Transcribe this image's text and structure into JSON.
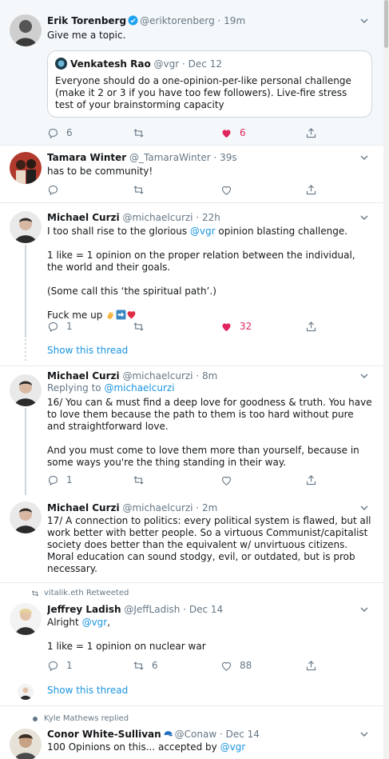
{
  "colors": {
    "accent": "#1b95e0",
    "like": "#e0245e",
    "muted": "#657786",
    "border": "#e6ecf0"
  },
  "tweets": [
    {
      "name": "Erik Torenberg",
      "handle": "@eriktorenberg",
      "time": "· 19m",
      "verified": true,
      "text": "Give me a topic.",
      "quote": {
        "name": "Venkatesh Rao",
        "handle": "@vgr",
        "time": "· Dec 12",
        "text": "Everyone should do a one-opinion-per-like personal challenge (make it 2 or 3 if you have too few followers). Live-fire stress test of your brainstorming capacity"
      },
      "reply_count": "6",
      "like_count": "6"
    },
    {
      "name": "Tamara Winter",
      "handle": "@_TamaraWinter",
      "time": "· 39s",
      "text": "has to be community!"
    },
    {
      "name": "Michael Curzi",
      "handle": "@michaelcurzi",
      "time": "· 22h",
      "line1_a": "I too shall rise to the glorious ",
      "line1_link": "@vgr",
      "line1_b": " opinion blasting challenge.",
      "para2": "1 like = 1 opinion on the proper relation between the individual, the world and their goals.",
      "para3": "(Some call this ‘the spiritual path’.)",
      "para4": "Fuck me up",
      "reply_count": "1",
      "like_count": "32"
    },
    {
      "name": "Michael Curzi",
      "handle": "@michaelcurzi",
      "time": "· 8m",
      "replying_label": "Replying to ",
      "replying_handle": "@michaelcurzi",
      "para1": "16/ You can & must find a deep love for goodness & truth. You have to love them because the path to them is too hard without pure and straightforward love.",
      "para2": "And you must come to love them more than yourself, because in some ways you're the thing standing in their way.",
      "reply_count": "1"
    },
    {
      "name": "Michael Curzi",
      "handle": "@michaelcurzi",
      "time": "· 2m",
      "text": "17/ A connection to politics: every political system is flawed, but all work better with better people. So a virtuous Communist/capitalist society does better than the equivalent w/ unvirtuous citizens. Moral education can sound stodgy, evil, or outdated, but is prob necessary."
    },
    {
      "context": "vitalik.eth Retweeted",
      "name": "Jeffrey Ladish",
      "handle": "@JeffLadish",
      "time": "· Dec 14",
      "line1_a": "Alright ",
      "line1_link": "@vgr",
      "line1_b": ",",
      "para2": "1 like = 1 opinion on nuclear war",
      "reply_count": "1",
      "retweet_count": "6",
      "like_count": "88"
    },
    {
      "context": "Kyle Mathews replied",
      "name": "Conor White-Sullivan",
      "handle": "@Conaw",
      "time": "· Dec 14",
      "text_a": "100 Opinions on this... accepted by ",
      "text_link": "@vgr"
    }
  ],
  "show_thread_label": "Show this thread"
}
